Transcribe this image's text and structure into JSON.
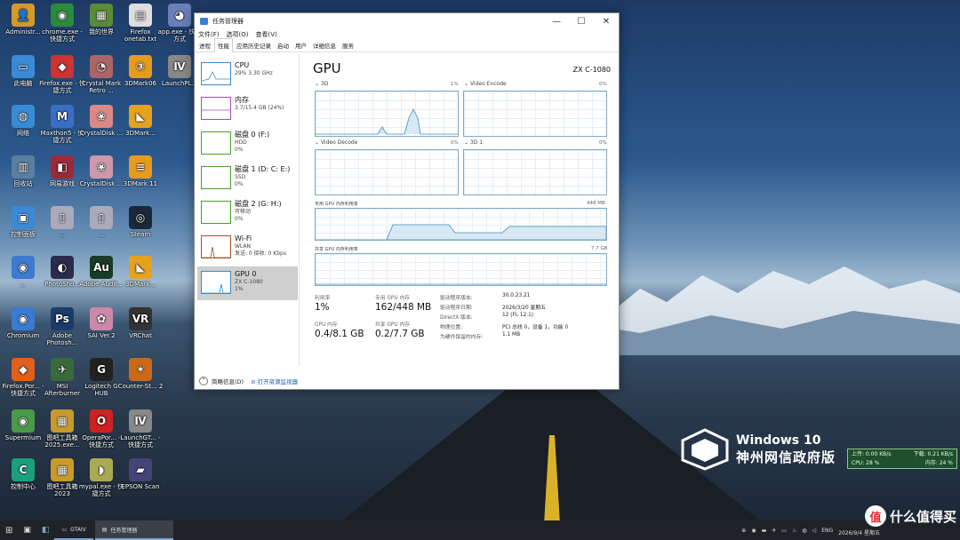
{
  "desktop": {
    "icons": [
      {
        "label": "Administr...",
        "glyph": "👤",
        "color": "#d49a2a"
      },
      {
        "label": "chrome.exe - 快捷方式",
        "glyph": "◉",
        "color": "#2c8a3c"
      },
      {
        "label": "我的世界",
        "glyph": "▦",
        "color": "#5a8a3a"
      },
      {
        "label": "Firefox onetab.txt",
        "glyph": "▤",
        "color": "#dddddd"
      },
      {
        "label": "app.exe - 快捷方式",
        "glyph": "◕",
        "color": "#6b7fb8"
      },
      {
        "label": "此电脑",
        "glyph": "▭",
        "color": "#3a8ad6"
      },
      {
        "label": "Firefox.exe - 快捷方式",
        "glyph": "◆",
        "color": "#c33"
      },
      {
        "label": "Crystal Mark Retro ...",
        "glyph": "◔",
        "color": "#a66"
      },
      {
        "label": "3DMark06",
        "glyph": "③",
        "color": "#e59b1e"
      },
      {
        "label": "LaunchPL...",
        "glyph": "Ⅳ",
        "color": "#888"
      },
      {
        "label": "网络",
        "glyph": "◍",
        "color": "#3a8ad6"
      },
      {
        "label": "Maxthon5 - 快捷方式",
        "glyph": "M",
        "color": "#3a6fc4"
      },
      {
        "label": "CrystalDisk ...",
        "glyph": "❀",
        "color": "#d88"
      },
      {
        "label": "3DMark...",
        "glyph": "◣",
        "color": "#e5a21e"
      },
      {
        "label": "回收站",
        "glyph": "▥",
        "color": "#5b7fa0"
      },
      {
        "label": "网易游戏",
        "glyph": "◧",
        "color": "#9a2a3a"
      },
      {
        "label": "CrystalDisk ...",
        "glyph": "❀",
        "color": "#c9a"
      },
      {
        "label": "3DMark 11",
        "glyph": "≡",
        "color": "#e59b1e"
      },
      {
        "label": "控制面板",
        "glyph": "▣",
        "color": "#3a8ad6"
      },
      {
        "label": "...",
        "glyph": "▯",
        "color": "#aab"
      },
      {
        "label": "...",
        "glyph": "▯",
        "color": "#aab"
      },
      {
        "label": "Steam",
        "glyph": "◎",
        "color": "#1b2838"
      },
      {
        "label": "...",
        "glyph": "◉",
        "color": "#3d7bd1"
      },
      {
        "label": "PhotoSho...",
        "glyph": "◐",
        "color": "#2a2a4a"
      },
      {
        "label": "Adobe Audit...",
        "glyph": "Au",
        "color": "#1a3a2a"
      },
      {
        "label": "3DMark...",
        "glyph": "◣",
        "color": "#e5a21e"
      },
      {
        "label": "Chromium",
        "glyph": "◉",
        "color": "#3a7ad1"
      },
      {
        "label": "Adobe Photosh...",
        "glyph": "Ps",
        "color": "#1b3b6b"
      },
      {
        "label": "SAI Ver.2",
        "glyph": "✿",
        "color": "#c8a"
      },
      {
        "label": "VRChat",
        "glyph": "VR",
        "color": "#333"
      },
      {
        "label": "Firefox.Por... - 快捷方式",
        "glyph": "◆",
        "color": "#e06020"
      },
      {
        "label": "MSI Afterburner",
        "glyph": "✈",
        "color": "#3a6a3a"
      },
      {
        "label": "Logitech G HUB",
        "glyph": "G",
        "color": "#222"
      },
      {
        "label": "Counter-St... 2",
        "glyph": "✶",
        "color": "#c96a1a"
      },
      {
        "label": "Supermium",
        "glyph": "◉",
        "color": "#4a9a4a"
      },
      {
        "label": "图吧工具箱 2025.exe...",
        "glyph": "▦",
        "color": "#c79a2a"
      },
      {
        "label": "OperaPor... - 快捷方式",
        "glyph": "O",
        "color": "#c22"
      },
      {
        "label": "LaunchGT... - 快捷方式",
        "glyph": "Ⅳ",
        "color": "#888"
      },
      {
        "label": "控制中心",
        "glyph": "C",
        "color": "#1aa07a"
      },
      {
        "label": "图吧工具箱 2023",
        "glyph": "▦",
        "color": "#c79a2a"
      },
      {
        "label": "mypal.exe - 快捷方式",
        "glyph": "◗",
        "color": "#aa5"
      },
      {
        "label": "EPSON Scan",
        "glyph": "▰",
        "color": "#447"
      }
    ]
  },
  "window": {
    "title": "任务管理器",
    "menu": [
      "文件(F)",
      "选项(O)",
      "查看(V)"
    ],
    "tabs": [
      "进程",
      "性能",
      "应用历史记录",
      "启动",
      "用户",
      "详细信息",
      "服务"
    ],
    "active_tab": "性能",
    "controls": {
      "minimize": "—",
      "maximize": "☐",
      "close": "✕"
    }
  },
  "sidebar": {
    "items": [
      {
        "name": "CPU",
        "line1": "29% 3.30 GHz",
        "line2": "",
        "color": "#3b8ac4"
      },
      {
        "name": "内存",
        "line1": "3.7/15.4 GB (24%)",
        "line2": "",
        "color": "#9b4db5"
      },
      {
        "name": "磁盘 0 (F:)",
        "line1": "HDD",
        "line2": "0%",
        "color": "#4aa02c"
      },
      {
        "name": "磁盘 1 (D: C: E:)",
        "line1": "SSD",
        "line2": "0%",
        "color": "#4aa02c"
      },
      {
        "name": "磁盘 2 (G: H:)",
        "line1": "可移动",
        "line2": "0%",
        "color": "#4aa02c"
      },
      {
        "name": "Wi-Fi",
        "line1": "WLAN",
        "line2": "发送: 0 接收: 0 Kbps",
        "color": "#a0522d"
      },
      {
        "name": "GPU 0",
        "line1": "ZX C-1080",
        "line2": "1%",
        "color": "#3b8ac4"
      }
    ]
  },
  "gpu": {
    "heading": "GPU",
    "model": "ZX C-1080",
    "engines": [
      {
        "name": "3D",
        "pct": "1%"
      },
      {
        "name": "Video Encode",
        "pct": "0%"
      },
      {
        "name": "Video Decode",
        "pct": "0%"
      },
      {
        "name": "3D 1",
        "pct": "0%"
      }
    ],
    "dedicated_label": "专用 GPU 内存利用率",
    "dedicated_max": "448 MB",
    "shared_label": "共享 GPU 内存利用率",
    "shared_max": "7.7 GB",
    "stats": {
      "util_label": "利用率",
      "util_value": "1%",
      "dedicated_mem_label": "专用 GPU 内存",
      "dedicated_mem_value": "162/448 MB",
      "gpu_mem_label": "GPU 内存",
      "gpu_mem_value": "0.4/8.1 GB",
      "shared_mem_label": "共享 GPU 内存",
      "shared_mem_value": "0.2/7.7 GB"
    },
    "info": [
      {
        "k": "驱动程序版本:",
        "v": "30.0.23.21"
      },
      {
        "k": "驱动程序日期:",
        "v": "2026/3/20 星期五"
      },
      {
        "k": "DirectX 版本:",
        "v": "12 (FL 12.1)"
      },
      {
        "k": "物理位置:",
        "v": "PCI 总线 0，设备 1，功能 0"
      },
      {
        "k": "为硬件保留的内存:",
        "v": "1.1 MB"
      }
    ]
  },
  "footer": {
    "brief": "简略信息(D)",
    "resource_monitor": "打开资源监视器"
  },
  "watermark": {
    "line1": "Windows 10",
    "line2": "神州网信政府版"
  },
  "netmon": {
    "upload": "上传: 0.00 KB/s",
    "download": "下载: 0.21 KB/s",
    "cpu": "CPU: 28 %",
    "mem": "内存: 24 %"
  },
  "taskbar": {
    "apps": [
      "GTAIV",
      "任务管理器"
    ],
    "lang": "ENG",
    "date": "2026/9/4 星期五"
  },
  "smzdm": {
    "logo": "值",
    "text": "什么值得买"
  }
}
